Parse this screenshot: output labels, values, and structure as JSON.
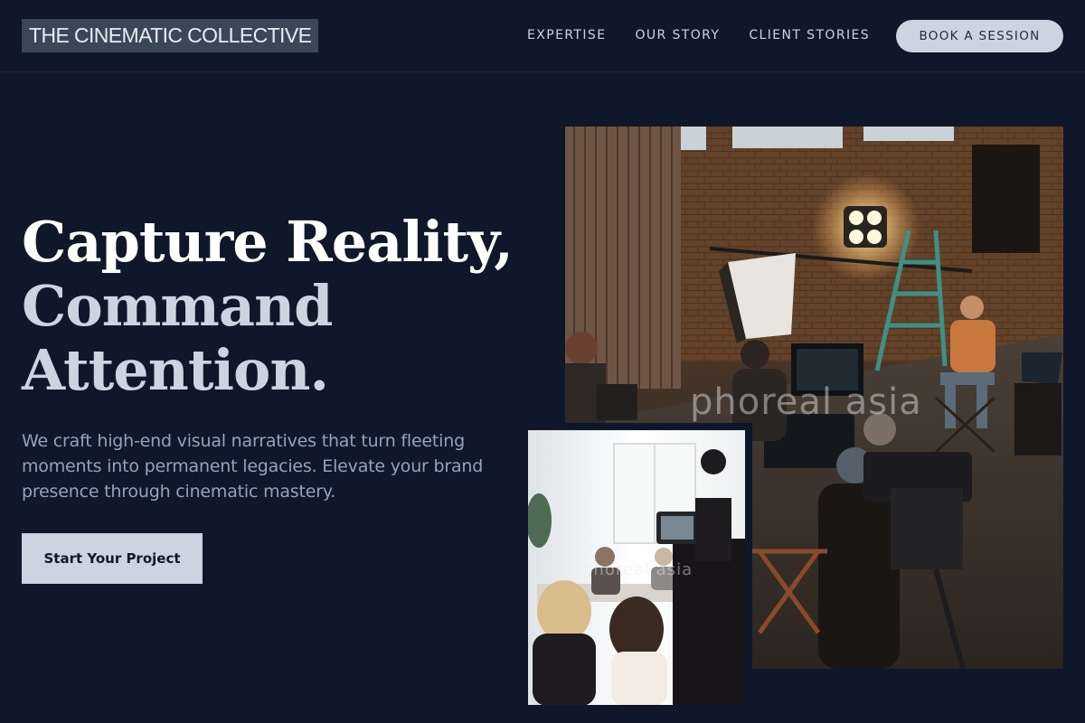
{
  "header": {
    "logo": "THE CINEMATIC COLLECTIVE",
    "nav": [
      {
        "label": "EXPERTISE"
      },
      {
        "label": "OUR STORY"
      },
      {
        "label": "CLIENT STORIES"
      }
    ],
    "cta_label": "BOOK A SESSION"
  },
  "hero": {
    "headline_line1": "Capture Reality,",
    "headline_line2": "Command",
    "headline_line3": "Attention.",
    "lede": "We craft high-end visual narratives that turn fleeting moments into permanent legacies. Elevate your brand presence through cinematic mastery.",
    "cta_label": "Start Your Project"
  },
  "images": {
    "main_watermark": "phoreal asia",
    "second_watermark": "phoreal asia"
  },
  "colors": {
    "background": "#0f172a",
    "accent": "#cbd5e1",
    "muted_text": "#94a3b8"
  }
}
